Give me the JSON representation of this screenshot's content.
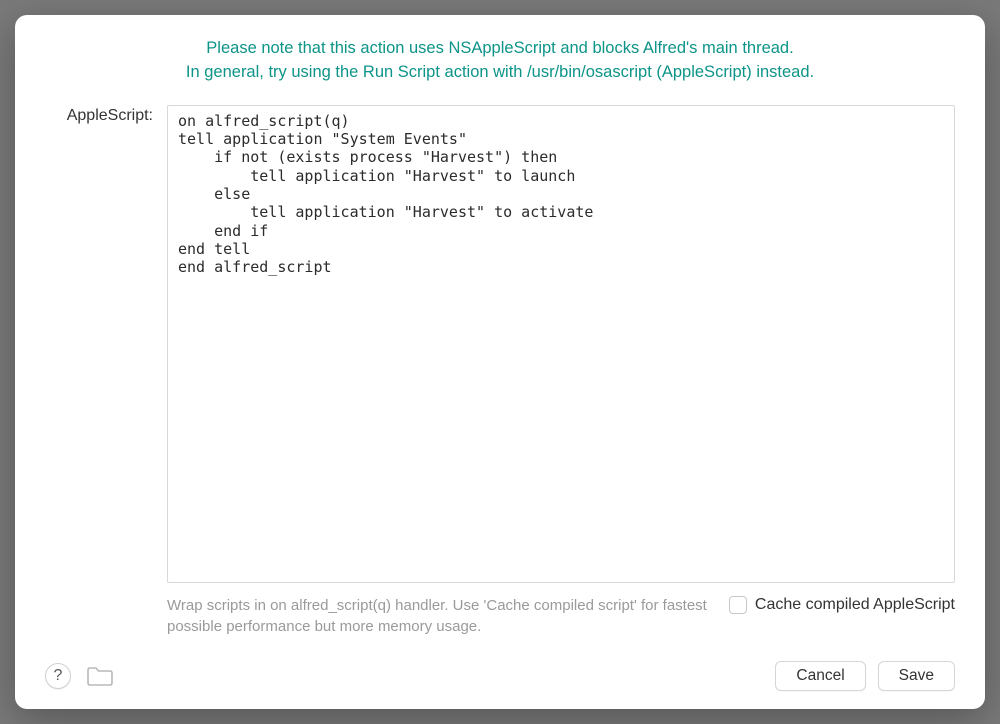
{
  "notice": {
    "line1": "Please note that this action uses NSAppleScript and blocks Alfred's main thread.",
    "line2": "In general, try using the Run Script action with /usr/bin/osascript (AppleScript) instead."
  },
  "form": {
    "label": "AppleScript:",
    "script": "on alfred_script(q)\ntell application \"System Events\"\n    if not (exists process \"Harvest\") then\n        tell application \"Harvest\" to launch\n    else\n        tell application \"Harvest\" to activate\n    end if\nend tell\nend alfred_script",
    "hint": "Wrap scripts in on alfred_script(q) handler. Use 'Cache compiled script' for fastest possible performance but more memory usage.",
    "checkbox_label": "Cache compiled AppleScript"
  },
  "footer": {
    "help": "?",
    "cancel": "Cancel",
    "save": "Save"
  }
}
